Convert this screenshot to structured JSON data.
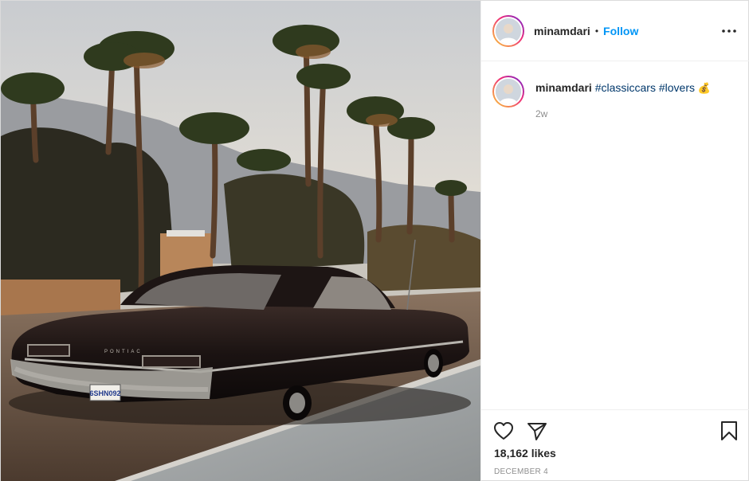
{
  "post": {
    "photo_alt": "classic car photo",
    "colors": {
      "accent": "#0095f6",
      "hashtag": "#00376b",
      "muted": "#8e8e8e"
    }
  },
  "header": {
    "username": "minamdari",
    "separator": "•",
    "follow_label": "Follow",
    "more_icon": "more-options-icon"
  },
  "caption": {
    "username": "minamdari",
    "hashtags": [
      "#classiccars",
      "#lovers"
    ],
    "emoji": "💰",
    "timestamp": "2w"
  },
  "actions": {
    "icons": [
      "heart-icon",
      "share-icon",
      "bookmark-icon"
    ],
    "likes": "18,162 likes",
    "date": "DECEMBER 4"
  },
  "photo": {
    "license_plate": "6SHN092",
    "car_badge": "PONTIAC"
  }
}
